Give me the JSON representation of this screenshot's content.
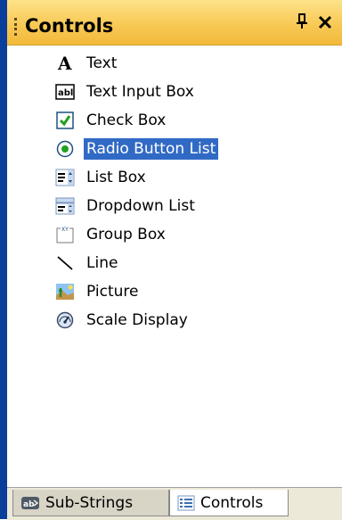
{
  "panel": {
    "title": "Controls",
    "pin_glyph": "I",
    "close_glyph": "×"
  },
  "items": [
    {
      "label": "Text",
      "icon": "text-a-icon"
    },
    {
      "label": "Text Input Box",
      "icon": "abl-textbox-icon"
    },
    {
      "label": "Check Box",
      "icon": "checkbox-icon"
    },
    {
      "label": "Radio Button List",
      "icon": "radio-icon"
    },
    {
      "label": "List Box",
      "icon": "listbox-icon"
    },
    {
      "label": "Dropdown List",
      "icon": "dropdown-icon"
    },
    {
      "label": "Group Box",
      "icon": "groupbox-icon"
    },
    {
      "label": "Line",
      "icon": "line-icon"
    },
    {
      "label": "Picture",
      "icon": "picture-icon"
    },
    {
      "label": "Scale Display",
      "icon": "gauge-icon"
    }
  ],
  "selected_index": 3,
  "tabs": [
    {
      "label": "Sub-Strings",
      "icon": "ab-strings-icon",
      "active": false
    },
    {
      "label": "Controls",
      "icon": "controls-icon",
      "active": true
    }
  ],
  "colors": {
    "title_bar": "#f8c955",
    "selection": "#316ac5",
    "left_rail": "#0a3e9b"
  }
}
